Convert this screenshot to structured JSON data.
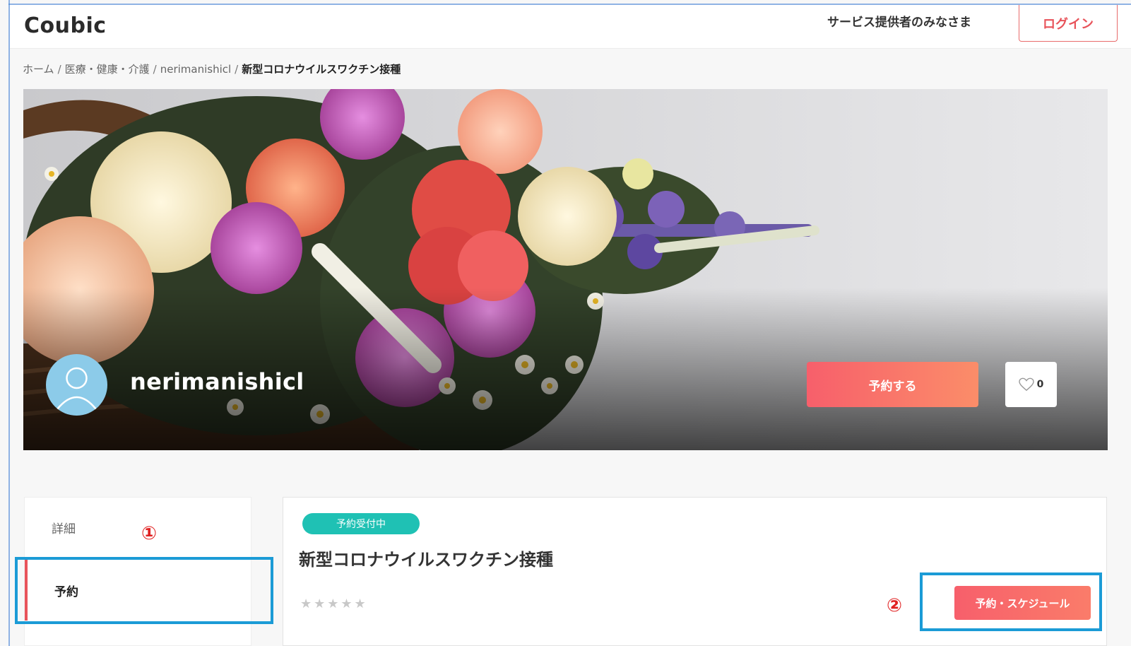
{
  "header": {
    "logo": "Coubic",
    "provider_link": "サービス提供者のみなさま",
    "login_label": "ログイン"
  },
  "breadcrumb": {
    "items": [
      "ホーム",
      "医療・健康・介護",
      "nerimanishicl"
    ],
    "current": "新型コロナウイルスワクチン接種",
    "separator": "/"
  },
  "banner": {
    "shop_name": "nerimanishicl",
    "reserve_label": "予約する",
    "like_count": "0"
  },
  "sidebar": {
    "tabs": [
      {
        "label": "詳細"
      },
      {
        "label": "予約"
      }
    ]
  },
  "card": {
    "status_badge": "予約受付中",
    "title": "新型コロナウイルスワクチン接種",
    "stars": "★★★★★",
    "schedule_label": "予約・スケジュール"
  },
  "annotations": {
    "marker_1": "①",
    "marker_2": "②"
  },
  "colors": {
    "accent": "#e8545b",
    "badge": "#1fc1b4",
    "highlight_box": "#1b9bd6"
  }
}
